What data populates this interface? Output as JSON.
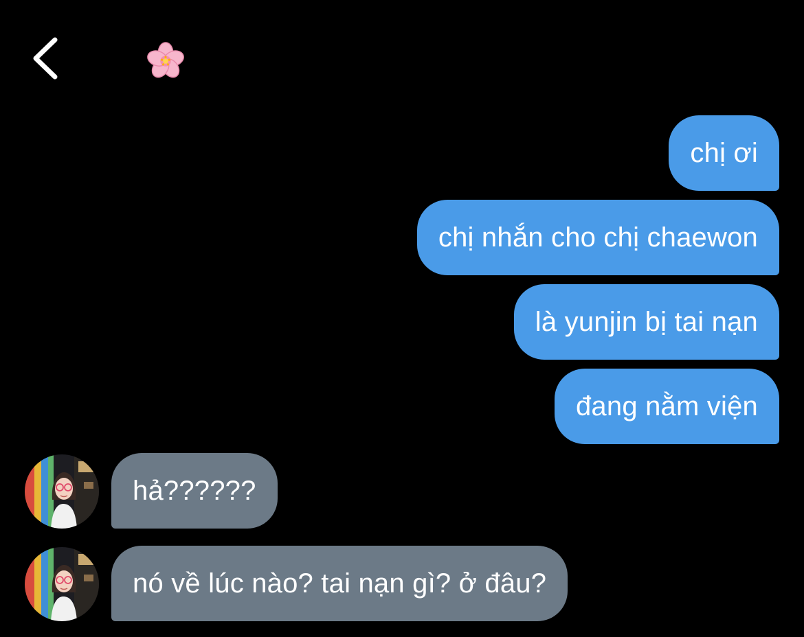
{
  "header": {
    "back_icon": "chevron-left-icon",
    "contact_icon": "cherry-blossom-icon",
    "colors": {
      "background": "#000000",
      "icon": "#ffffff"
    }
  },
  "conversation": {
    "colors": {
      "sent_bubble": "#4a9be8",
      "received_bubble": "#6c7a87",
      "text": "#ffffff"
    },
    "messages": [
      {
        "direction": "sent",
        "text": "chị ơi"
      },
      {
        "direction": "sent",
        "text": "chị nhắn cho chị chaewon"
      },
      {
        "direction": "sent",
        "text": "là yunjin bị tai nạn"
      },
      {
        "direction": "sent",
        "text": "đang nằm viện"
      },
      {
        "direction": "received",
        "text": "hả??????"
      },
      {
        "direction": "received",
        "text": "nó về lúc nào? tai nạn gì? ở đâu?"
      }
    ]
  }
}
